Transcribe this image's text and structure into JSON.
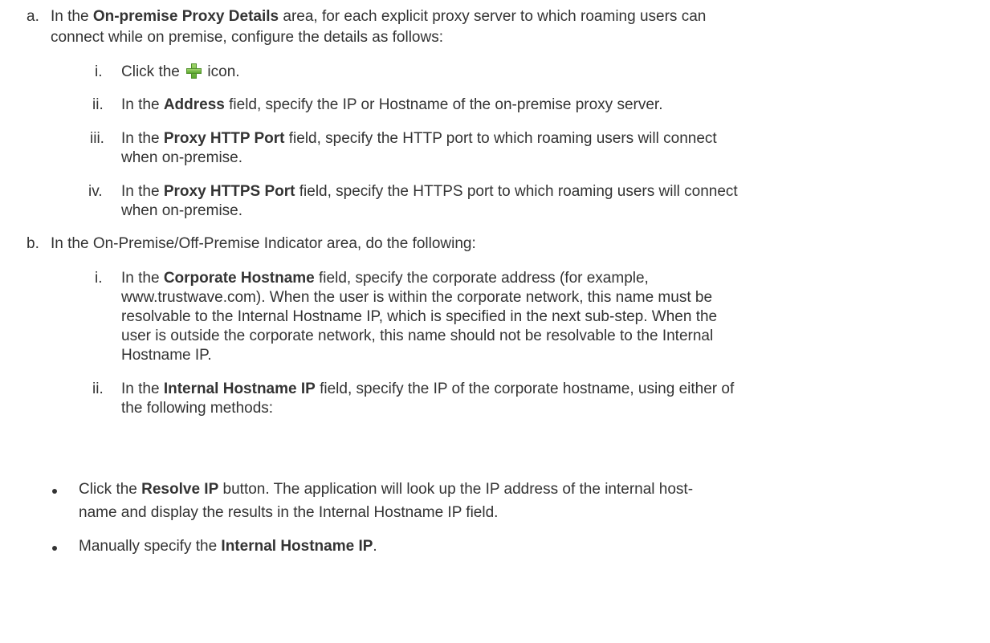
{
  "item_a": {
    "marker": "a.",
    "line1_pre": "In the ",
    "line1_bold": "On-premise Proxy Details",
    "line1_post": " area, for each explicit proxy server to which roaming users can",
    "line2": "connect while on premise, configure the details as follows:",
    "steps": [
      {
        "marker": "i.",
        "pre": "Click the ",
        "icon": "add-plus-icon",
        "post": " icon."
      },
      {
        "marker": "ii.",
        "pre": "In the ",
        "bold": "Address",
        "post": " field, specify the IP or Hostname of the on-premise proxy server."
      },
      {
        "marker": "iii.",
        "pre": "In the ",
        "bold": "Proxy HTTP Port",
        "post": " field, specify the HTTP port to which roaming users will connect",
        "line2": "when on-premise."
      },
      {
        "marker": "iv.",
        "pre": "In the ",
        "bold": "Proxy HTTPS Port",
        "post": " field, specify the HTTPS port to which roaming users will connect",
        "line2": "when on-premise."
      }
    ]
  },
  "item_b": {
    "marker": "b.",
    "text": "In the On-Premise/Off-Premise Indicator area, do the following:",
    "steps": [
      {
        "marker": "i.",
        "pre": "In the ",
        "bold": "Corporate Hostname",
        "post": " field, specify the corporate address (for example,",
        "lines": [
          "www.trustwave.com). When the user is within the corporate network, this name must be",
          "resolvable to the Internal Hostname IP, which is specified in the next sub-step. When the",
          "user is outside the corporate network, this name should not be resolvable to the Internal",
          "Hostname IP."
        ]
      },
      {
        "marker": "ii.",
        "pre": "In the ",
        "bold": "Internal Hostname IP",
        "post": " field, specify the IP of the corporate hostname, using either of",
        "line2": "the following methods:"
      }
    ]
  },
  "bullets": [
    {
      "pre": "Click the ",
      "bold": "Resolve IP",
      "post": " button. The application will look up the IP address of the internal host-",
      "line2": "name and display the results in the Internal Hostname IP field."
    },
    {
      "pre": "Manually specify the ",
      "bold": "Internal Hostname IP",
      "post": "."
    }
  ]
}
